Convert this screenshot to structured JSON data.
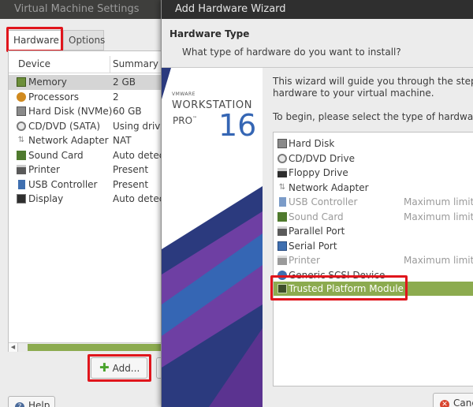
{
  "settings_window": {
    "title": "Virtual Machine Settings",
    "tabs": [
      {
        "label": "Hardware",
        "active": true
      },
      {
        "label": "Options",
        "active": false
      }
    ],
    "columns": {
      "device": "Device",
      "summary": "Summary"
    },
    "devices": [
      {
        "icon": "memory-icon",
        "name": "Memory",
        "summary": "2 GB",
        "selected": true
      },
      {
        "icon": "processor-icon",
        "name": "Processors",
        "summary": "2"
      },
      {
        "icon": "hard-disk-icon",
        "name": "Hard Disk (NVMe)",
        "summary": "60 GB"
      },
      {
        "icon": "cd-dvd-icon",
        "name": "CD/DVD (SATA)",
        "summary": "Using drive"
      },
      {
        "icon": "network-adapter-icon",
        "name": "Network Adapter",
        "summary": "NAT"
      },
      {
        "icon": "sound-card-icon",
        "name": "Sound Card",
        "summary": "Auto detect"
      },
      {
        "icon": "printer-icon",
        "name": "Printer",
        "summary": "Present"
      },
      {
        "icon": "usb-controller-icon",
        "name": "USB Controller",
        "summary": "Present"
      },
      {
        "icon": "display-icon",
        "name": "Display",
        "summary": "Auto detect"
      }
    ],
    "add_label": "Add...",
    "help_label": "Help"
  },
  "wizard": {
    "title": "Add Hardware Wizard",
    "heading": "Hardware Type",
    "subheading": "What type of hardware do you want to install?",
    "brand": {
      "vendor": "VMWARE",
      "product": "WORKSTATION",
      "edition": "PRO",
      "trademark": "™",
      "version": "16"
    },
    "intro_line1": "This wizard will guide you through the steps",
    "intro_line2": "hardware to your virtual machine.",
    "intro_prompt": "To begin, please select the type of hardware",
    "hardware_types": [
      {
        "icon": "hard-disk-icon",
        "name": "Hard Disk",
        "limit": "",
        "enabled": true
      },
      {
        "icon": "cd-dvd-icon",
        "name": "CD/DVD Drive",
        "limit": "",
        "enabled": true
      },
      {
        "icon": "floppy-icon",
        "name": "Floppy Drive",
        "limit": "",
        "enabled": true
      },
      {
        "icon": "network-adapter-icon",
        "name": "Network Adapter",
        "limit": "",
        "enabled": true
      },
      {
        "icon": "usb-controller-icon",
        "name": "USB Controller",
        "limit": "Maximum limit",
        "enabled": false
      },
      {
        "icon": "sound-card-icon",
        "name": "Sound Card",
        "limit": "Maximum limit",
        "enabled": false
      },
      {
        "icon": "parallel-port-icon",
        "name": "Parallel Port",
        "limit": "",
        "enabled": true
      },
      {
        "icon": "serial-port-icon",
        "name": "Serial Port",
        "limit": "",
        "enabled": true
      },
      {
        "icon": "printer-icon",
        "name": "Printer",
        "limit": "Maximum limit",
        "enabled": false
      },
      {
        "icon": "scsi-device-icon",
        "name": "Generic SCSI Device",
        "limit": "",
        "enabled": true
      },
      {
        "icon": "tpm-icon",
        "name": "Trusted Platform Module",
        "limit": "",
        "enabled": true,
        "selected": true
      }
    ],
    "cancel_label": "Cancel"
  },
  "colors": {
    "selection_green": "#8cab4f",
    "highlight_red": "#e0151c",
    "brand_blue": "#3566b4",
    "banner_navy": "#2b3a7e",
    "banner_purple": "#6e3fa3"
  }
}
